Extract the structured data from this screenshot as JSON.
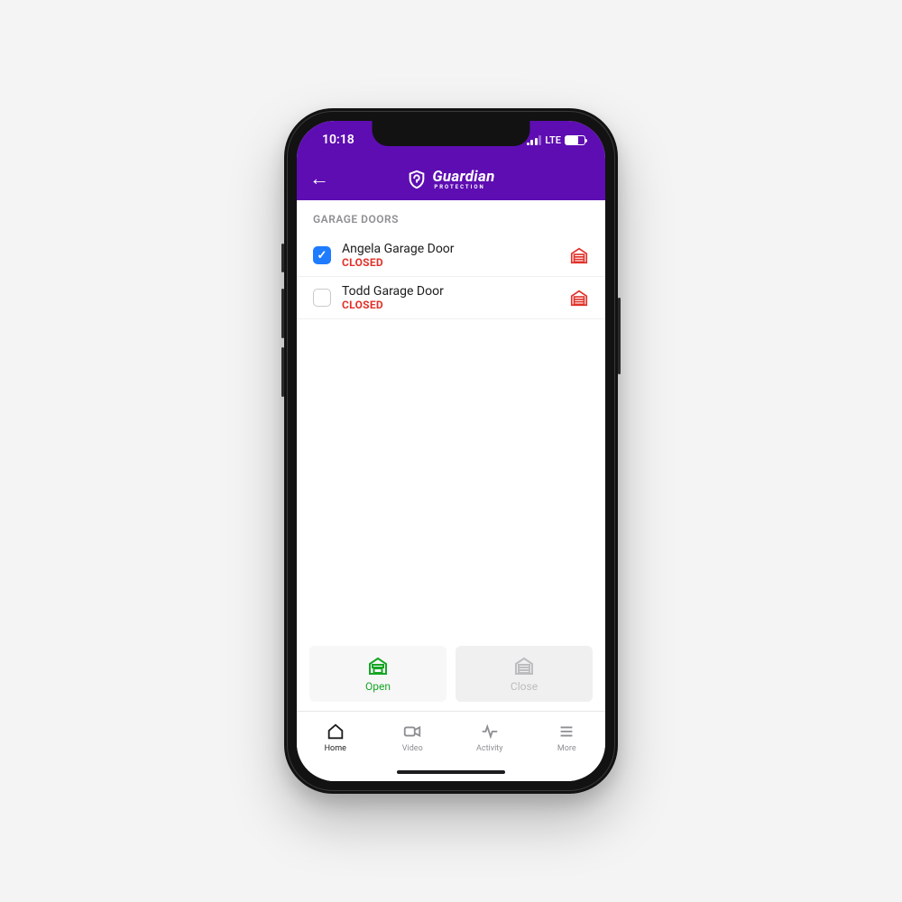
{
  "status": {
    "time": "10:18",
    "network": "LTE"
  },
  "brand": {
    "name": "Guardian",
    "sub": "PROTECTION"
  },
  "section_title": "GARAGE DOORS",
  "doors": [
    {
      "name": "Angela Garage Door",
      "status": "CLOSED",
      "checked": true
    },
    {
      "name": "Todd Garage Door",
      "status": "CLOSED",
      "checked": false
    }
  ],
  "actions": {
    "open": "Open",
    "close": "Close"
  },
  "tabs": {
    "home": "Home",
    "video": "Video",
    "activity": "Activity",
    "more": "More"
  },
  "colors": {
    "accent": "#5e0db2",
    "status_red": "#e1312a",
    "action_green": "#17a625"
  }
}
